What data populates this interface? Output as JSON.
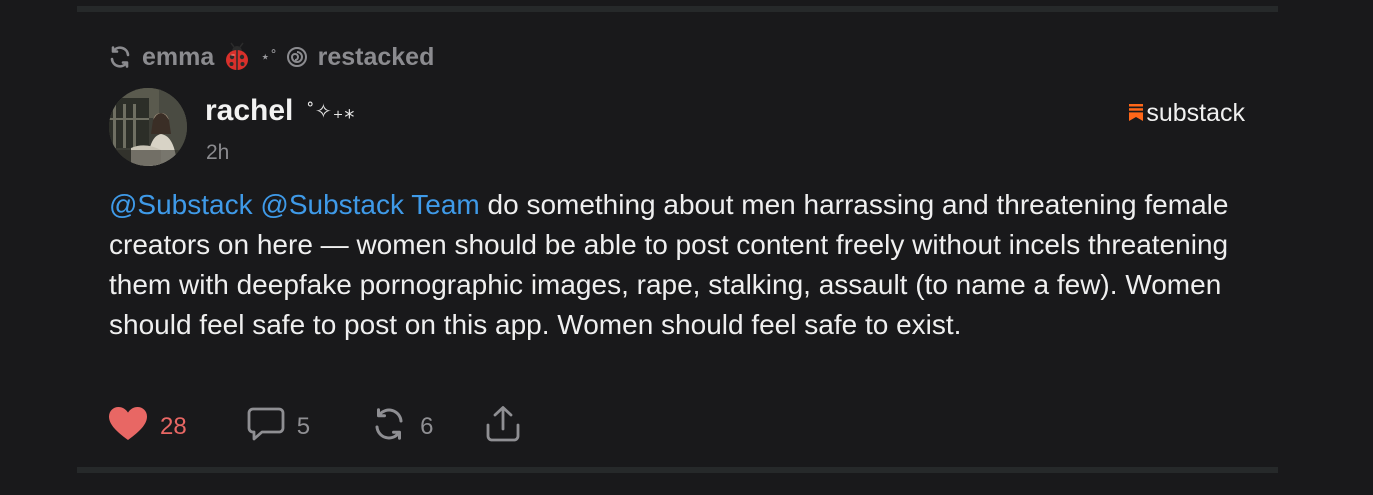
{
  "restack": {
    "icon": "restack-icon",
    "user": "emma",
    "emoji": "ladybug-icon",
    "decoration": "⋆˚",
    "decoration_icon": "swirl-icon",
    "action_label": "restacked"
  },
  "post": {
    "author": {
      "name": "rachel",
      "name_decoration": "˚✧₊⁎",
      "avatar": "avatar-photo"
    },
    "timestamp": "2h",
    "publication": {
      "logo_icon": "substack-logo-icon",
      "name": "substack"
    },
    "mentions": [
      "@Substack",
      "@Substack Team"
    ],
    "text_after_mentions": " do something about men harrassing and threatening female creators on here — women should be able to post content freely without incels threatening them with deepfake pornographic images, rape, stalking, assault (to name a few). Women should feel safe to post on this app. Women should feel safe to exist."
  },
  "actions": {
    "like": {
      "icon": "heart-icon",
      "count": "28",
      "color": "#e86764",
      "liked": true
    },
    "comment": {
      "icon": "comment-icon",
      "count": "5"
    },
    "restack": {
      "icon": "restack-icon",
      "count": "6"
    },
    "share": {
      "icon": "share-icon"
    }
  },
  "colors": {
    "background": "#19191b",
    "mention": "#3f9ae8",
    "brand_accent": "#ff6719",
    "muted": "#8b8b8f"
  }
}
